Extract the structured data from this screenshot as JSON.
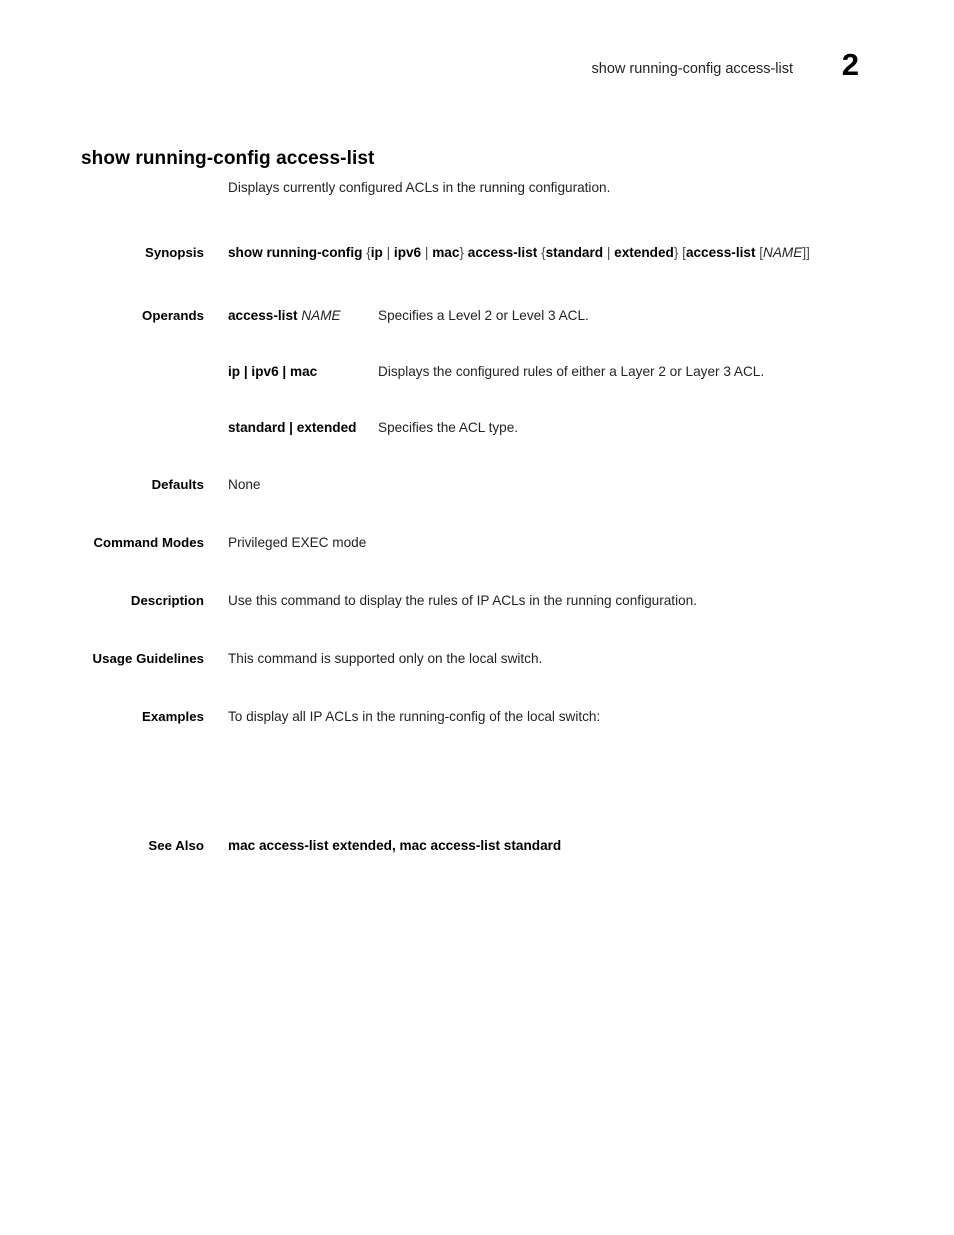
{
  "header": {
    "running_title": "show running-config access-list",
    "page_number": "2"
  },
  "command": {
    "title": "show running-config access-list",
    "intro": "Displays currently configured ACLs in the running configuration."
  },
  "labels": {
    "synopsis": "Synopsis",
    "operands": "Operands",
    "defaults": "Defaults",
    "command_modes": "Command Modes",
    "description": "Description",
    "usage_guidelines": "Usage Guidelines",
    "examples": "Examples",
    "see_also": "See Also"
  },
  "synopsis": {
    "full_text": "show running-config {ip | ipv6 | mac} access-list {standard | extended} [access-list [NAME]]",
    "tokens": {
      "cmd": "show running-config",
      "open_brace_1": "{",
      "ip": "ip",
      "pipe_1": "|",
      "ipv6": "ipv6",
      "pipe_2": "|",
      "mac": "mac",
      "close_brace_1": "}",
      "access_list": "access-list",
      "open_brace_2": "{",
      "standard": "standard",
      "pipe_3": "|",
      "extended": "extended",
      "close_brace_2": "}",
      "open_bracket_1": "[",
      "access_list_2": "access-list",
      "open_bracket_2": "[",
      "name": "NAME",
      "close_brackets": "]]"
    }
  },
  "operands": [
    {
      "term_bold": "access-list",
      "term_italic": "NAME",
      "description": "Specifies a Level 2 or Level 3 ACL."
    },
    {
      "term_bold": "ip | ipv6 | mac",
      "term_italic": "",
      "description": "Displays the configured rules of either a Layer 2 or Layer 3 ACL."
    },
    {
      "term_bold": "standard | extended",
      "term_italic": "",
      "description": "Specifies the ACL type."
    }
  ],
  "defaults": "None",
  "command_modes": "Privileged EXEC mode",
  "description": "Use this command to display the rules of IP ACLs in the running configuration.",
  "usage_guidelines": "This command is supported only on the local switch.",
  "examples": "To display all IP ACLs in the running-config of the local switch:",
  "see_also": "mac access-list extended, mac access-list standard",
  "colors": {
    "text": "#231f20",
    "heading": "#000000",
    "punctuation": "#4a4a4a",
    "background": "#ffffff"
  }
}
